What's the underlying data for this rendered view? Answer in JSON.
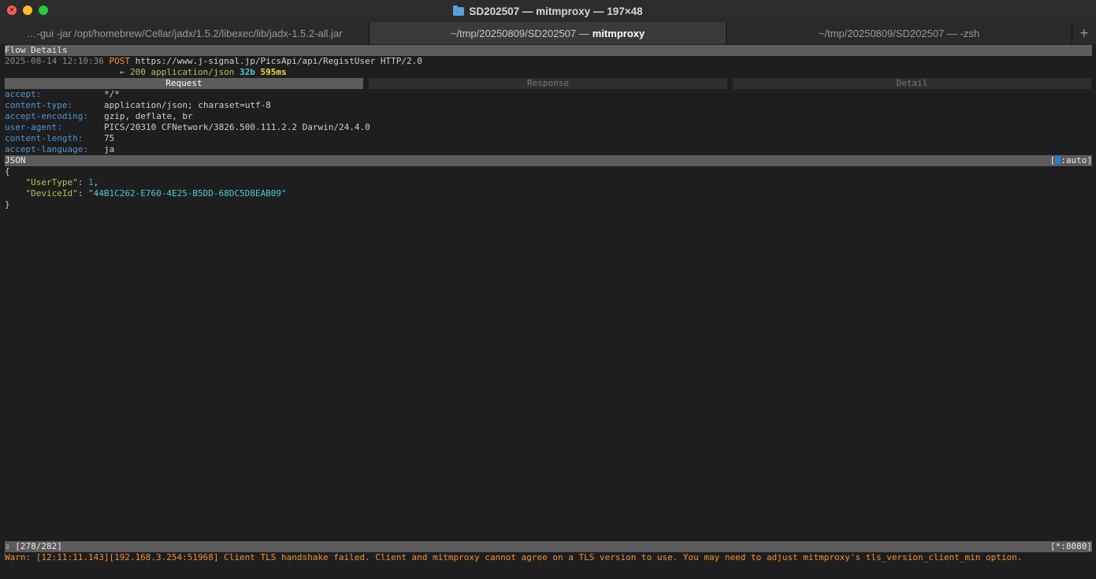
{
  "window": {
    "title": "SD202507 — mitmproxy — 197×48"
  },
  "tabs": [
    {
      "label": "…-gui -jar /opt/homebrew/Cellar/jadx/1.5.2/libexec/lib/jadx-1.5.2-all.jar"
    },
    {
      "label": "~/tmp/20250809/SD202507 —",
      "bold": "mitmproxy"
    },
    {
      "label": "~/tmp/20250809/SD202507 — -zsh"
    }
  ],
  "tab_add_label": "+",
  "flow": {
    "section_title": "Flow Details",
    "timestamp": "2025-08-14 12:10:36",
    "method": "POST",
    "url": "https://www.j-signal.jp/PicsApi/api/RegistUser HTTP/2.0",
    "response_arrow": "←",
    "status_code": "200",
    "content_type": "application/json",
    "size": "32b",
    "duration": "595ms"
  },
  "detail_tabs": {
    "request": "Request",
    "response": "Response",
    "detail": "Detail"
  },
  "headers": [
    {
      "key": "accept:",
      "value": "*/*"
    },
    {
      "key": "content-type:",
      "value": "application/json; charaset=utf-8"
    },
    {
      "key": "accept-encoding:",
      "value": "gzip, deflate, br"
    },
    {
      "key": "user-agent:",
      "value": "PICS/20310 CFNetwork/3826.500.111.2.2 Darwin/24.4.0"
    },
    {
      "key": "content-length:",
      "value": "75"
    },
    {
      "key": "accept-language:",
      "value": "ja"
    }
  ],
  "body": {
    "view_label": "JSON",
    "mode_prefix": "[",
    "mode_label": ":auto]",
    "open_brace": "{",
    "close_brace": "}",
    "entries": [
      {
        "key": "\"UserType\"",
        "sep": ": ",
        "value": "1",
        "trail": ","
      },
      {
        "key": "\"DeviceId\"",
        "sep": ": ",
        "value": "\"44B1C262-E760-4E25-B5DD-68DC5D8EAB09\"",
        "trail": ""
      }
    ]
  },
  "status": {
    "position": "⇩  [278/282]",
    "listen": "[*:8080]",
    "warning": "Warn: [12:11:11.143][192.168.3.254:51968] Client TLS handshake failed. Client and mitmproxy cannot agree on a TLS version to use. You may need to adjust mitmproxy's tls_version_client_min option."
  }
}
